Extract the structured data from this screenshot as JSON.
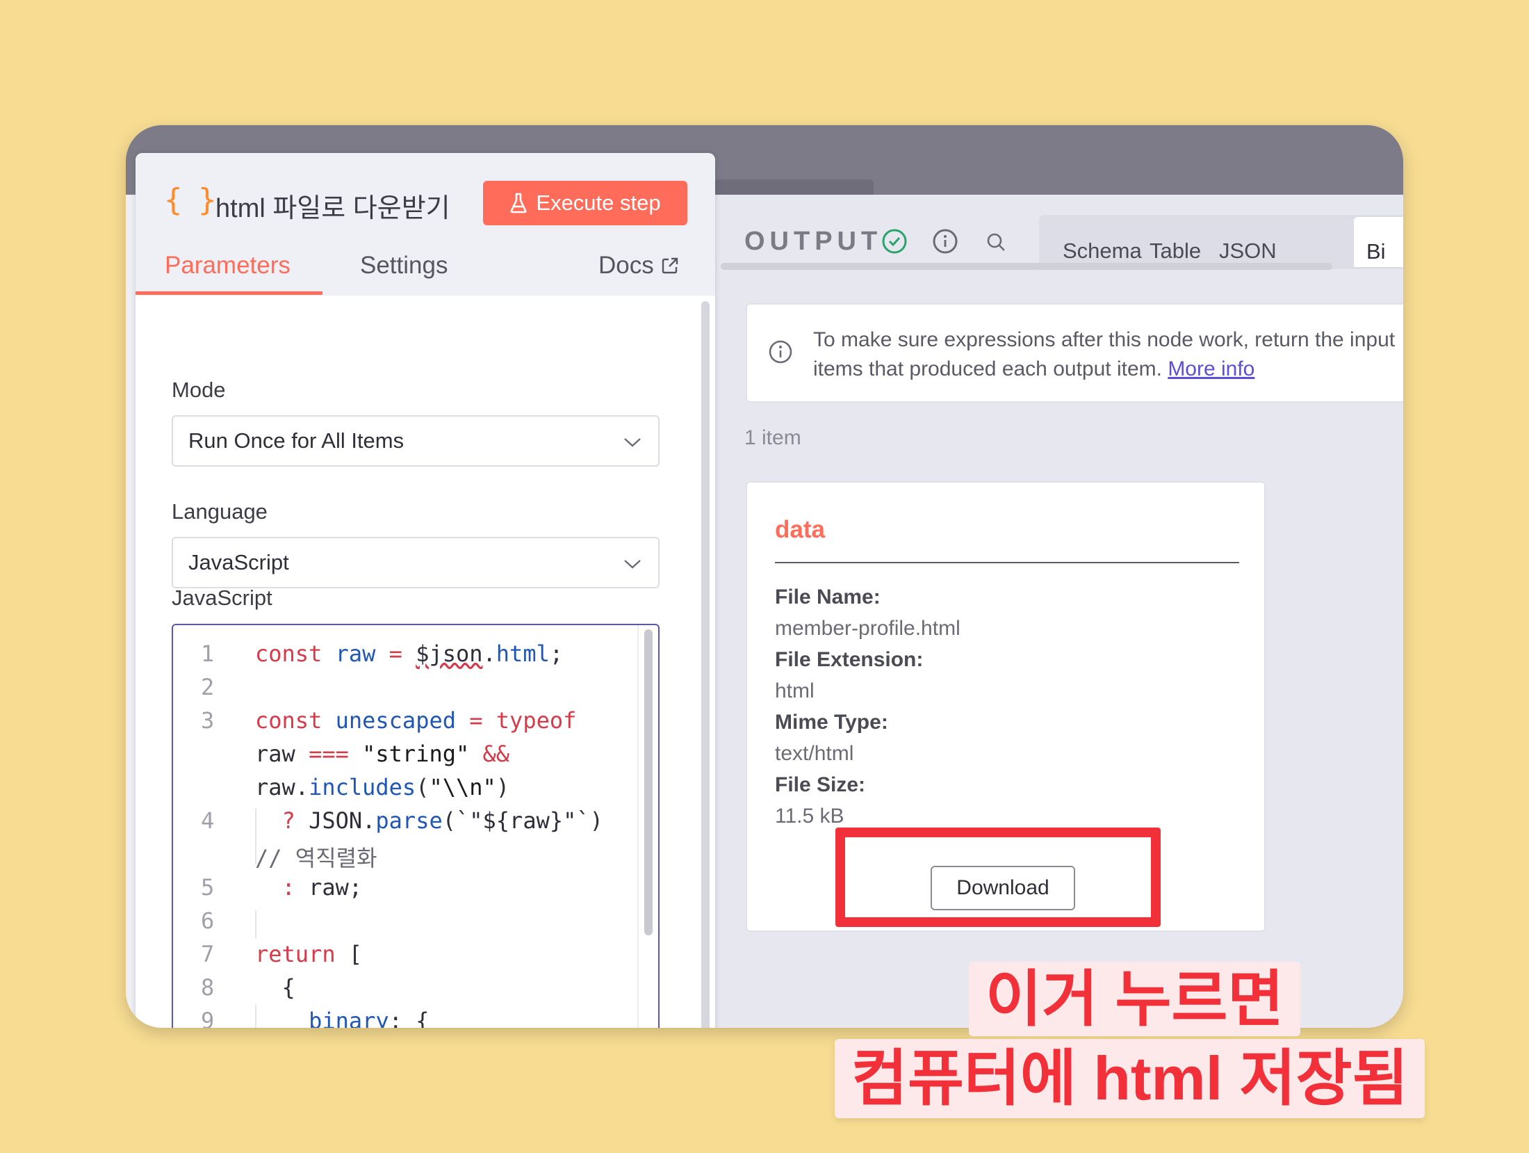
{
  "node": {
    "title": "html 파일로 다운받기",
    "execute_label": "Execute step"
  },
  "tabs": {
    "parameters": "Parameters",
    "settings": "Settings",
    "docs": "Docs"
  },
  "fields": {
    "mode_label": "Mode",
    "mode_value": "Run Once for All Items",
    "language_label": "Language",
    "language_value": "JavaScript",
    "code_label": "JavaScript"
  },
  "code_lines": [
    {
      "n": "1",
      "text": "const raw = $json.html;"
    },
    {
      "n": "2",
      "text": ""
    },
    {
      "n": "3",
      "text": "const unescaped = typeof raw === \"string\" && raw.includes(\"\\\\n\")"
    },
    {
      "n": "4",
      "text": "? JSON.parse(`\"${raw}\"`) // 역직렬화"
    },
    {
      "n": "5",
      "text": ": raw;"
    },
    {
      "n": "6",
      "text": ""
    },
    {
      "n": "7",
      "text": "return ["
    },
    {
      "n": "8",
      "text": "{"
    },
    {
      "n": "9",
      "text": "binary: {"
    }
  ],
  "output": {
    "title": "OUTPUT",
    "view_tabs": [
      "Schema",
      "Table",
      "JSON",
      "Binary"
    ],
    "active_view": "Binary",
    "notice_text": "To make sure expressions after this node work, return the input items that produced each output item.",
    "notice_link": "More info",
    "item_count": "1 item",
    "binary": {
      "key": "data",
      "fields": [
        {
          "label": "File Name:",
          "value": "member-profile.html"
        },
        {
          "label": "File Extension:",
          "value": "html"
        },
        {
          "label": "Mime Type:",
          "value": "text/html"
        },
        {
          "label": "File Size:",
          "value": "11.5 kB"
        }
      ],
      "download_label": "Download"
    }
  },
  "annotation": {
    "line1": "이거 누르면",
    "line2": "컴퓨터에 html 저장됨"
  },
  "colors": {
    "accent": "#ff6d5a",
    "annotation_red": "#f2303a",
    "background": "#f7dc92",
    "link": "#5a4fd6"
  }
}
